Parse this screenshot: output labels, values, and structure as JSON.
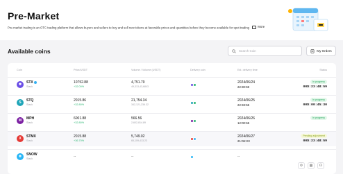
{
  "header": {
    "title": "Pre-Market",
    "description": "Pre-market trading is an OTC trading platform that allows buyers and sellers to buy and sell new tokens at favorable prices and quantities before they become available for spot trading",
    "more_label": "More"
  },
  "section": {
    "title": "Available coins",
    "search_placeholder": "Search Coin",
    "my_orders_label": "My Orders"
  },
  "table": {
    "columns": [
      "Coin",
      "Price/USDT",
      "Volume / Volume (USDT)",
      "Delivery coin",
      "Est. delivery time",
      "Status"
    ],
    "rows": [
      {
        "symbol": "STX",
        "verified": true,
        "name": "Stack",
        "price": "10752.88",
        "change": "+32.00%",
        "volume": "4,751.79",
        "volume_usdt": "49,313,43,6843",
        "delivery_date": "2024/06/24",
        "delivery_time": "22:30:59",
        "status": "In progress",
        "countdown": "00D:23:48:59",
        "logo_color": "#6b4ee6",
        "logo_char": "✱",
        "chain_colors": [
          "#6b4ee6",
          "#2bb673"
        ]
      },
      {
        "symbol": "STQ",
        "verified": false,
        "name": "Stack",
        "price": "2015.86",
        "change": "+32.80%",
        "volume": "21,754.34",
        "volume_usdt": "342,121,236.32",
        "delivery_date": "2024/06/25",
        "delivery_time": "22:33:55",
        "status": "In progress",
        "countdown": "00D:00:45:30",
        "logo_color": "#1fa5b8",
        "logo_char": "S",
        "chain_colors": [
          "#1fa5b8",
          "#2bb673"
        ]
      },
      {
        "symbol": "MPH",
        "verified": false,
        "name": "Stack",
        "price": "6001.88",
        "change": "+32.80%",
        "volume": "566.56",
        "volume_usdt": "2,602,814.89",
        "delivery_date": "2024/06/26",
        "delivery_time": "12:00:65",
        "status": "In progress",
        "countdown": "",
        "logo_color": "#7b1fa2",
        "logo_char": "M",
        "chain_colors": [
          "#7b1fa2",
          "#2bb673"
        ]
      },
      {
        "symbol": "STMX",
        "verified": false,
        "name": "Stack",
        "price": "2015.88",
        "change": "+36.70%",
        "volume": "5,749.02",
        "volume_usdt": "65,109,413.23",
        "delivery_date": "2024/06/27",
        "delivery_time": "21:06:XX",
        "status": "Pending adjustment",
        "countdown": "00D:23:48:59",
        "logo_color": "#e53935",
        "logo_char": "X",
        "chain_colors": [
          "#e53935",
          "#35b1f2"
        ]
      },
      {
        "symbol": "SNOW",
        "verified": false,
        "name": "Stack",
        "price": "--",
        "change": "",
        "volume": "--",
        "volume_usdt": "",
        "delivery_date": "--",
        "delivery_time": "",
        "status": "",
        "countdown": "",
        "logo_color": "#29b6f6",
        "logo_char": "❄",
        "chain_colors": [
          "#29b6f6"
        ]
      }
    ]
  },
  "colors": {
    "accent_green": "#2bb673",
    "pending_yellow": "#8da21e",
    "bg": "#f4f4f6"
  }
}
